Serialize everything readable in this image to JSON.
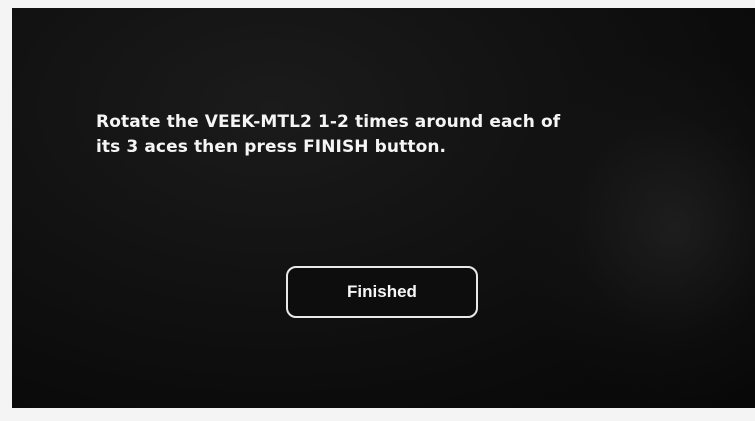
{
  "calibration": {
    "instruction_line1": "Rotate the VEEK-MTL2 1-2 times around each of",
    "instruction_line2": "its 3 aces then press FINISH button.",
    "finish_button_label": "Finished"
  },
  "colors": {
    "screen_background": "#111111",
    "text": "#f5f5f5",
    "button_border": "#e9e9e9"
  }
}
